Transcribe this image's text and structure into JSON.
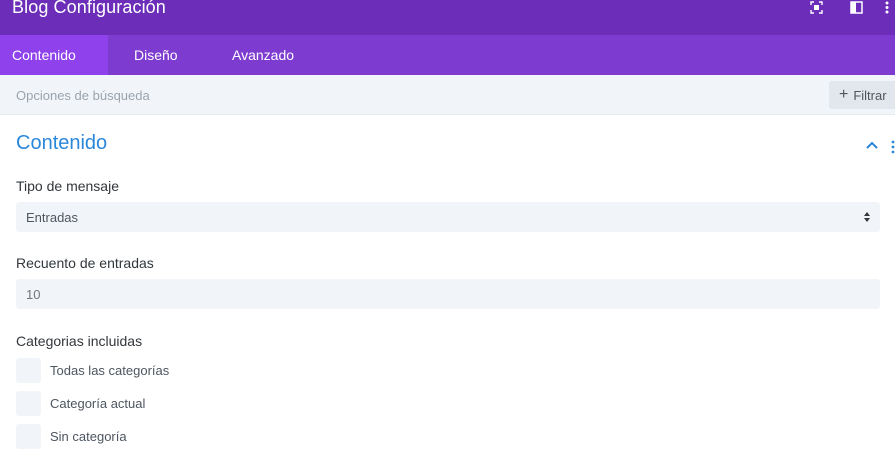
{
  "header": {
    "title": "Blog Configuración",
    "icons": [
      "expand-icon",
      "layout-columns-icon",
      "kebab-menu-icon"
    ],
    "background_color": "#6c2eb9"
  },
  "tabs": [
    {
      "label": "Contenido",
      "active": true
    },
    {
      "label": "Diseño",
      "active": false
    },
    {
      "label": "Avanzado",
      "active": false
    }
  ],
  "search": {
    "placeholder": "Opciones de búsqueda",
    "filter_label": "Filtrar"
  },
  "section": {
    "title": "Contenido",
    "accent_color": "#2b87da"
  },
  "fields": {
    "post_type": {
      "label": "Tipo de mensaje",
      "value": "Entradas"
    },
    "post_count": {
      "label": "Recuento de entradas",
      "placeholder": "10"
    },
    "categories": {
      "label": "Categorias incluidas",
      "options": [
        {
          "label": "Todas las categorías",
          "checked": false
        },
        {
          "label": "Categoría actual",
          "checked": false
        },
        {
          "label": "Sin categoría",
          "checked": false
        }
      ]
    }
  }
}
